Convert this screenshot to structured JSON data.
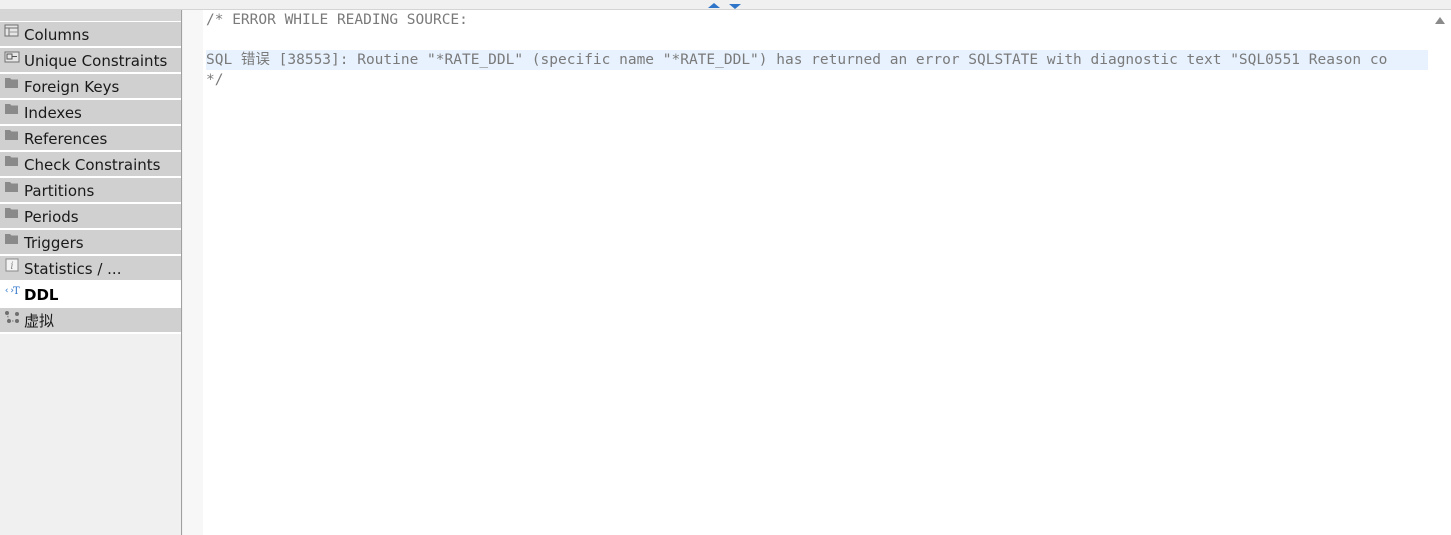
{
  "sidebar": {
    "tabs": [
      {
        "label": "Columns",
        "icon": "columns-icon",
        "active": false
      },
      {
        "label": "Unique Constraints",
        "icon": "unique-key-icon",
        "active": false
      },
      {
        "label": "Foreign Keys",
        "icon": "folder-icon",
        "active": false
      },
      {
        "label": "Indexes",
        "icon": "folder-icon",
        "active": false
      },
      {
        "label": "References",
        "icon": "folder-icon",
        "active": false
      },
      {
        "label": "Check Constraints",
        "icon": "folder-icon",
        "active": false
      },
      {
        "label": "Partitions",
        "icon": "folder-icon",
        "active": false
      },
      {
        "label": "Periods",
        "icon": "folder-icon",
        "active": false
      },
      {
        "label": "Triggers",
        "icon": "folder-icon",
        "active": false
      },
      {
        "label": "Statistics / ...",
        "icon": "info-icon",
        "active": false
      },
      {
        "label": "DDL",
        "icon": "ddl-icon",
        "active": true
      },
      {
        "label": "虚拟",
        "icon": "virtual-icon",
        "active": false
      }
    ]
  },
  "editor": {
    "lines": [
      "/* ERROR WHILE READING SOURCE:",
      "",
      "SQL 错误 [38553]: Routine \"*RATE_DDL\" (specific name \"*RATE_DDL\") has returned an error SQLSTATE with diagnostic text \"SQL0551 Reason co",
      "*/"
    ]
  },
  "colors": {
    "accent": "#2e75c9",
    "tab_bg": "#d0d0d0",
    "current_line": "#e8f2fe"
  }
}
